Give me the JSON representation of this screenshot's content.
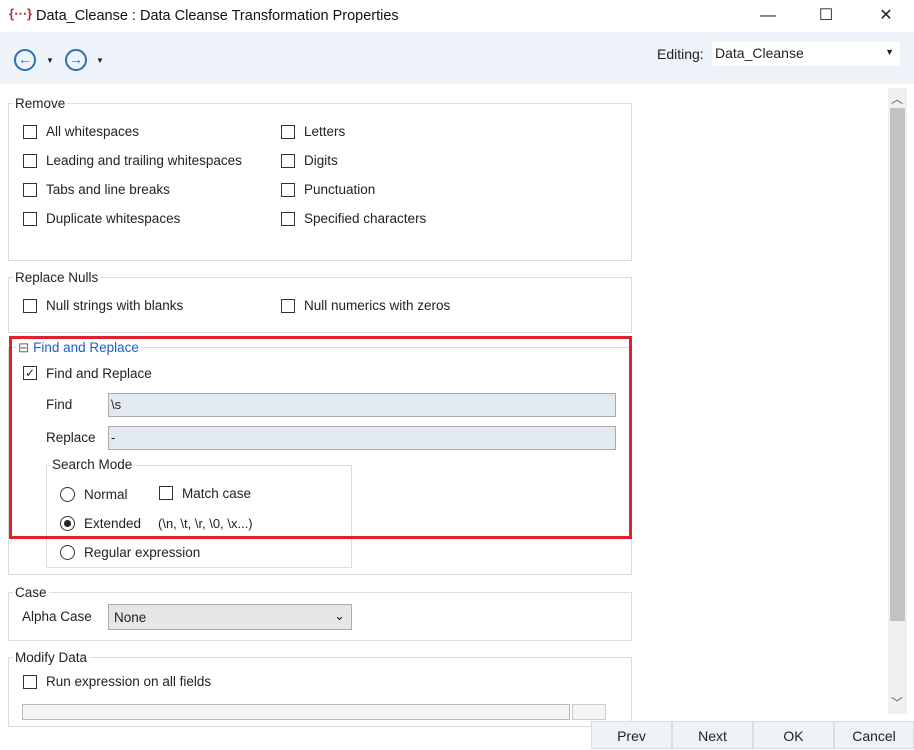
{
  "window": {
    "title": "Data_Cleanse : Data Cleanse Transformation Properties",
    "minimize": "—",
    "maximize": "☐",
    "close": "✕"
  },
  "toolbar": {
    "back_icon": "arrow-left-circle",
    "forward_icon": "arrow-right-circle",
    "editing_label": "Editing:",
    "editing_value": "Data_Cleanse"
  },
  "remove": {
    "legend": "Remove",
    "items": [
      {
        "label": "All whitespaces",
        "checked": false
      },
      {
        "label": "Leading and trailing whitespaces",
        "checked": false
      },
      {
        "label": "Tabs and line breaks",
        "checked": false
      },
      {
        "label": "Duplicate whitespaces",
        "checked": false
      },
      {
        "label": "Letters",
        "checked": false
      },
      {
        "label": "Digits",
        "checked": false
      },
      {
        "label": "Punctuation",
        "checked": false
      },
      {
        "label": "Specified characters",
        "checked": false
      }
    ]
  },
  "replace_nulls": {
    "legend": "Replace Nulls",
    "items": [
      {
        "label": "Null strings with blanks",
        "checked": false
      },
      {
        "label": "Null numerics with zeros",
        "checked": false
      }
    ]
  },
  "find_replace": {
    "legend": "Find and Replace",
    "collapse": "⊟",
    "enable_label": "Find and Replace",
    "enabled": true,
    "find_label": "Find",
    "find_value": "\\s",
    "replace_label": "Replace",
    "replace_value": "-",
    "search_mode": {
      "legend": "Search Mode",
      "normal": "Normal",
      "extended": "Extended",
      "extended_hint": "(\\n, \\t, \\r, \\0, \\x...)",
      "regex": "Regular expression",
      "selected": "Extended",
      "match_case": "Match case",
      "match_case_checked": false
    }
  },
  "case": {
    "legend": "Case",
    "alpha_label": "Alpha Case",
    "alpha_value": "None"
  },
  "modify": {
    "legend": "Modify Data",
    "run_label": "Run expression on all fields",
    "checked": false
  },
  "buttons": {
    "prev": "Prev",
    "next": "Next",
    "ok": "OK",
    "cancel": "Cancel"
  },
  "colors": {
    "highlight": "#e0202a",
    "link": "#1a5fc8"
  }
}
